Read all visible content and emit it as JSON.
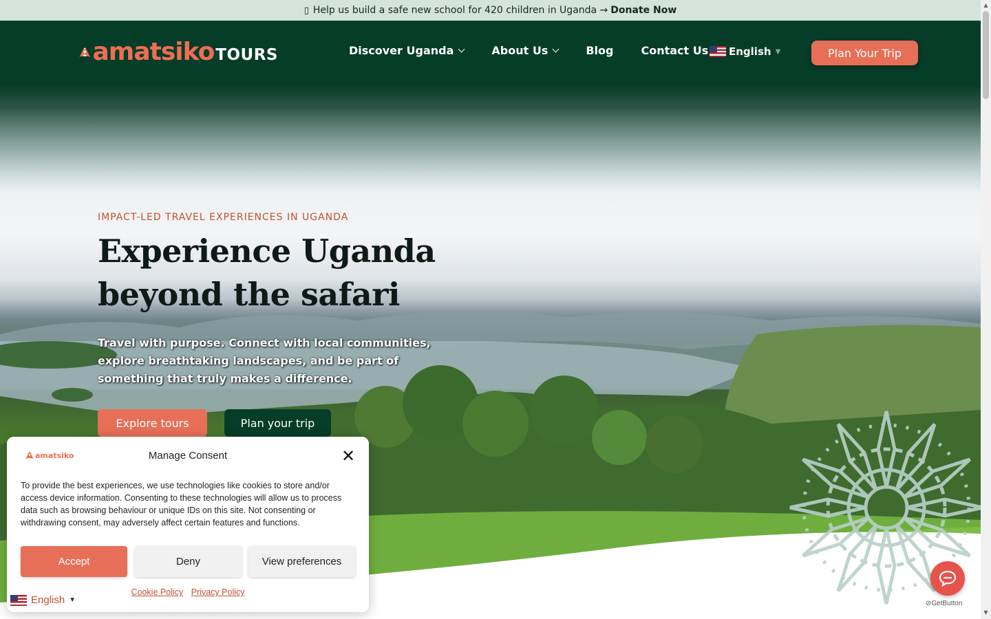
{
  "announcement": {
    "text": "Help us build a safe new school for 420 children in Uganda →",
    "link": "Donate Now"
  },
  "header": {
    "logo_main": "amatsiko",
    "logo_sub": "TOURS",
    "nav": [
      {
        "label": "Discover Uganda"
      },
      {
        "label": "About Us"
      },
      {
        "label": "Blog"
      },
      {
        "label": "Contact Us"
      }
    ],
    "language": "English",
    "cta": "Plan Your Trip"
  },
  "hero": {
    "eyebrow": "IMPACT-LED TRAVEL EXPERIENCES IN UGANDA",
    "headline_line1": "Experience Uganda",
    "headline_line2": "beyond the safari",
    "subtext": "Travel with purpose. Connect with local communities, explore breathtaking landscapes, and be part of something that truly makes a difference.",
    "primary_button": "Explore tours",
    "secondary_button": "Plan your trip"
  },
  "consent": {
    "logo": "amatsiko",
    "title": "Manage Consent",
    "body": "To provide the best experiences, we use technologies like cookies to store and/or access device information. Consenting to these technologies will allow us to process data such as browsing behaviour or unique IDs on this site. Not consenting or withdrawing consent, may adversely affect certain features and functions.",
    "accept": "Accept",
    "deny": "Deny",
    "preferences": "View preferences",
    "cookie_policy": "Cookie Policy",
    "privacy_policy": "Privacy Policy"
  },
  "language_selector": {
    "label": "English"
  },
  "chat": {
    "badge": "GetButton"
  },
  "colors": {
    "brand_green": "#063d28",
    "brand_coral": "#e76f57",
    "announcement_bg": "#d4e3dc",
    "eyebrow": "#c2512f"
  },
  "icons": [
    "pin-icon",
    "chevron-down-icon",
    "us-flag-icon",
    "close-icon",
    "chat-bubble-icon",
    "mandala-decoration"
  ]
}
